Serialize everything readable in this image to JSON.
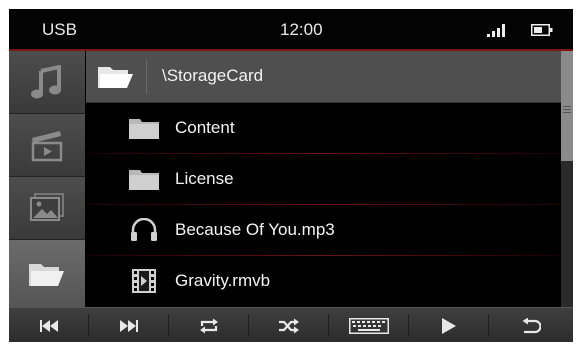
{
  "status": {
    "source": "USB",
    "time": "12:00"
  },
  "sidebar": {
    "tabs": [
      {
        "name": "music-tab",
        "icon": "music-note-icon"
      },
      {
        "name": "video-tab",
        "icon": "video-clapper-icon"
      },
      {
        "name": "photo-tab",
        "icon": "picture-icon"
      },
      {
        "name": "folder-tab",
        "icon": "folder-icon",
        "active": true
      }
    ]
  },
  "path": "\\StorageCard",
  "files": [
    {
      "name": "Content",
      "type": "folder"
    },
    {
      "name": "License",
      "type": "folder"
    },
    {
      "name": "Because Of You.mp3",
      "type": "audio"
    },
    {
      "name": "Gravity.rmvb",
      "type": "video"
    }
  ],
  "toolbar": {
    "buttons": [
      "previous",
      "next",
      "repeat",
      "shuffle",
      "keyboard",
      "play",
      "back"
    ]
  },
  "colors": {
    "accent": "#7a1616",
    "background": "#000000"
  }
}
